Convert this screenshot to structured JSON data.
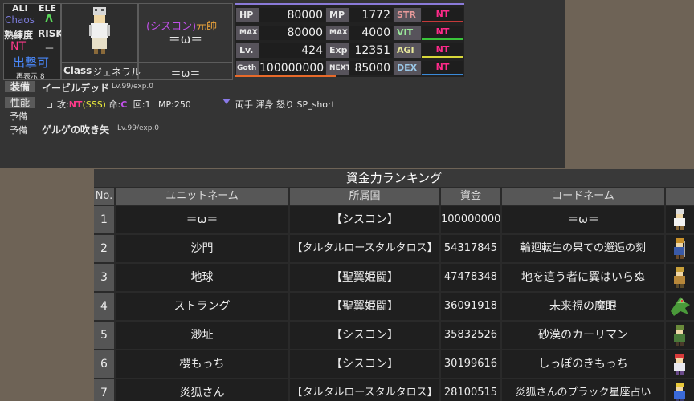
{
  "profile": {
    "ali_label": "ALI",
    "ele_label": "ELE",
    "alignment": "Chaos",
    "element_mark": "Λ",
    "mastery_label": "熟練度",
    "risk_label": "RISK",
    "mastery_value": "NT",
    "risk_value": "－",
    "attack_status": "出撃可",
    "redisplay": "再表示 8",
    "faction": "(シスコン)",
    "rank_title": "元帥",
    "unit_name": "＝ω＝",
    "class_label": "Class",
    "class_value": "ジェネラル",
    "code_name": "＝ω＝"
  },
  "stats": {
    "hp_label": "HP",
    "hp": "80000",
    "mp_label": "MP",
    "mp": "1772",
    "max_label": "MAX",
    "hp_max": "80000",
    "mp_max_label": "MAX",
    "mp_max": "4000",
    "lv_label": "Lv.",
    "lv": "424",
    "exp_label": "Exp",
    "exp": "12351",
    "goth_label": "Goth",
    "goth": "100000000",
    "next_label": "NEXT",
    "next": "85000",
    "str_label": "STR",
    "vit_label": "VIT",
    "agi_label": "AGI",
    "dex_label": "DEX",
    "str": "NT",
    "vit": "NT",
    "agi": "NT",
    "dex": "NT",
    "colors": {
      "str": "#c43a3a",
      "vit": "#3ac43a",
      "agi": "#d8d83a",
      "dex": "#3a8ad8"
    }
  },
  "equipment": {
    "equip_label": "装備",
    "weapon_name": "イービルデッド",
    "weapon_level": "Lv.99/exp.0",
    "ability_label": "性能",
    "atk_prefix": "攻:",
    "atk_type": "NT",
    "atk_rank": "(SSS)",
    "hit_prefix": "命:",
    "hit_value": "C",
    "times": "回:1",
    "mp_cost": "MP:250",
    "ability_text": "両手 渾身 怒り SP_short",
    "spare1_label": "予備",
    "spare2_label": "予備",
    "spare2_item": "ゲルゲの吹き矢",
    "spare2_level": "Lv.99/exp.0"
  },
  "ranking": {
    "title": "資金力ランキング",
    "headers": [
      "No.",
      "ユニットネーム",
      "所属国",
      "資金",
      "コードネーム"
    ],
    "rows": [
      {
        "no": "1",
        "name": "＝ω＝",
        "country": "【シスコン】",
        "funds": "100000000",
        "code": "＝ω＝"
      },
      {
        "no": "2",
        "name": "沙門",
        "country": "【タルタルロースタルタロス】",
        "funds": "54317845",
        "code": "輪廻転生の果ての邂逅の刻"
      },
      {
        "no": "3",
        "name": "地球",
        "country": "【聖翼姫闘】",
        "funds": "47478348",
        "code": "地を這う者に翼はいらぬ"
      },
      {
        "no": "4",
        "name": "ストラング",
        "country": "【聖翼姫闘】",
        "funds": "36091918",
        "code": "未来視の魔眼"
      },
      {
        "no": "5",
        "name": "渺址",
        "country": "【シスコン】",
        "funds": "35832526",
        "code": "砂漠のカーリマン"
      },
      {
        "no": "6",
        "name": "櫻もっち",
        "country": "【シスコン】",
        "funds": "30199616",
        "code": "しっぽのきもっち"
      },
      {
        "no": "7",
        "name": "炎狐さん",
        "country": "【タルタルロースタルタロス】",
        "funds": "28100515",
        "code": "炎狐さんのブラック星座占い"
      }
    ]
  }
}
